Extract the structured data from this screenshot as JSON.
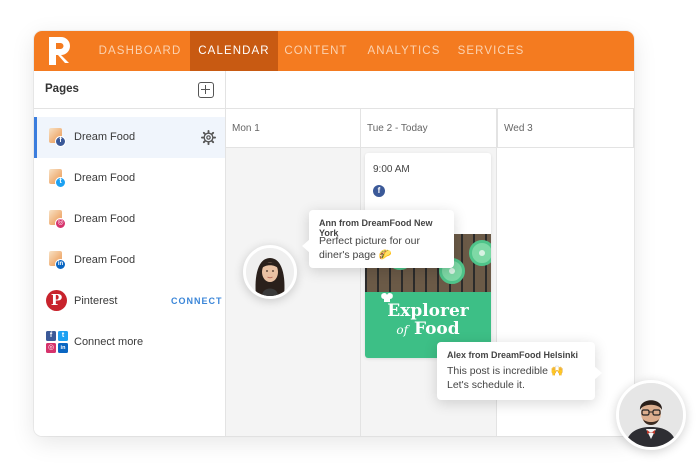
{
  "colors": {
    "brand_orange": "#f47b20",
    "active_tab": "#c85a12",
    "connect_blue": "#3b86d8",
    "facebook": "#3b5998",
    "twitter": "#1da1f2",
    "instagram": "#d6336c",
    "linkedin": "#0a66c2",
    "pinterest": "#c8232c"
  },
  "topnav": {
    "tabs": [
      {
        "label": "DASHBOARD",
        "active": false
      },
      {
        "label": "CALENDAR",
        "active": true
      },
      {
        "label": "CONTENT",
        "active": false
      },
      {
        "label": "ANALYTICS",
        "active": false
      },
      {
        "label": "SERVICES",
        "active": false
      }
    ]
  },
  "sidebar": {
    "title": "Pages",
    "pages": [
      {
        "label": "Dream Food",
        "network": "facebook",
        "active": true
      },
      {
        "label": "Dream Food",
        "network": "twitter",
        "active": false
      },
      {
        "label": "Dream Food",
        "network": "instagram",
        "active": false
      },
      {
        "label": "Dream Food",
        "network": "linkedin",
        "active": false
      }
    ],
    "pinterest": {
      "label": "Pinterest",
      "action": "CONNECT"
    },
    "connect_more": {
      "label": "Connect more"
    },
    "network_glyphs": {
      "facebook": "f",
      "twitter": "t",
      "instagram": "◎",
      "linkedin": "in"
    }
  },
  "calendar": {
    "days": [
      "Mon 1",
      "Tue 2 - Today",
      "Wed 3"
    ],
    "post": {
      "time": "9:00 AM",
      "network_glyph": "f",
      "headline_small": "of",
      "headline_1": "Explorer",
      "headline_2": "Food"
    }
  },
  "comments": [
    {
      "author": "Ann from DreamFood New York",
      "line1": "Perfect picture for our",
      "line2": "diner's page 🌮"
    },
    {
      "author": "Alex from DreamFood Helsinki",
      "line1": "This post is incredible 🙌",
      "line2": "Let's schedule it."
    }
  ]
}
